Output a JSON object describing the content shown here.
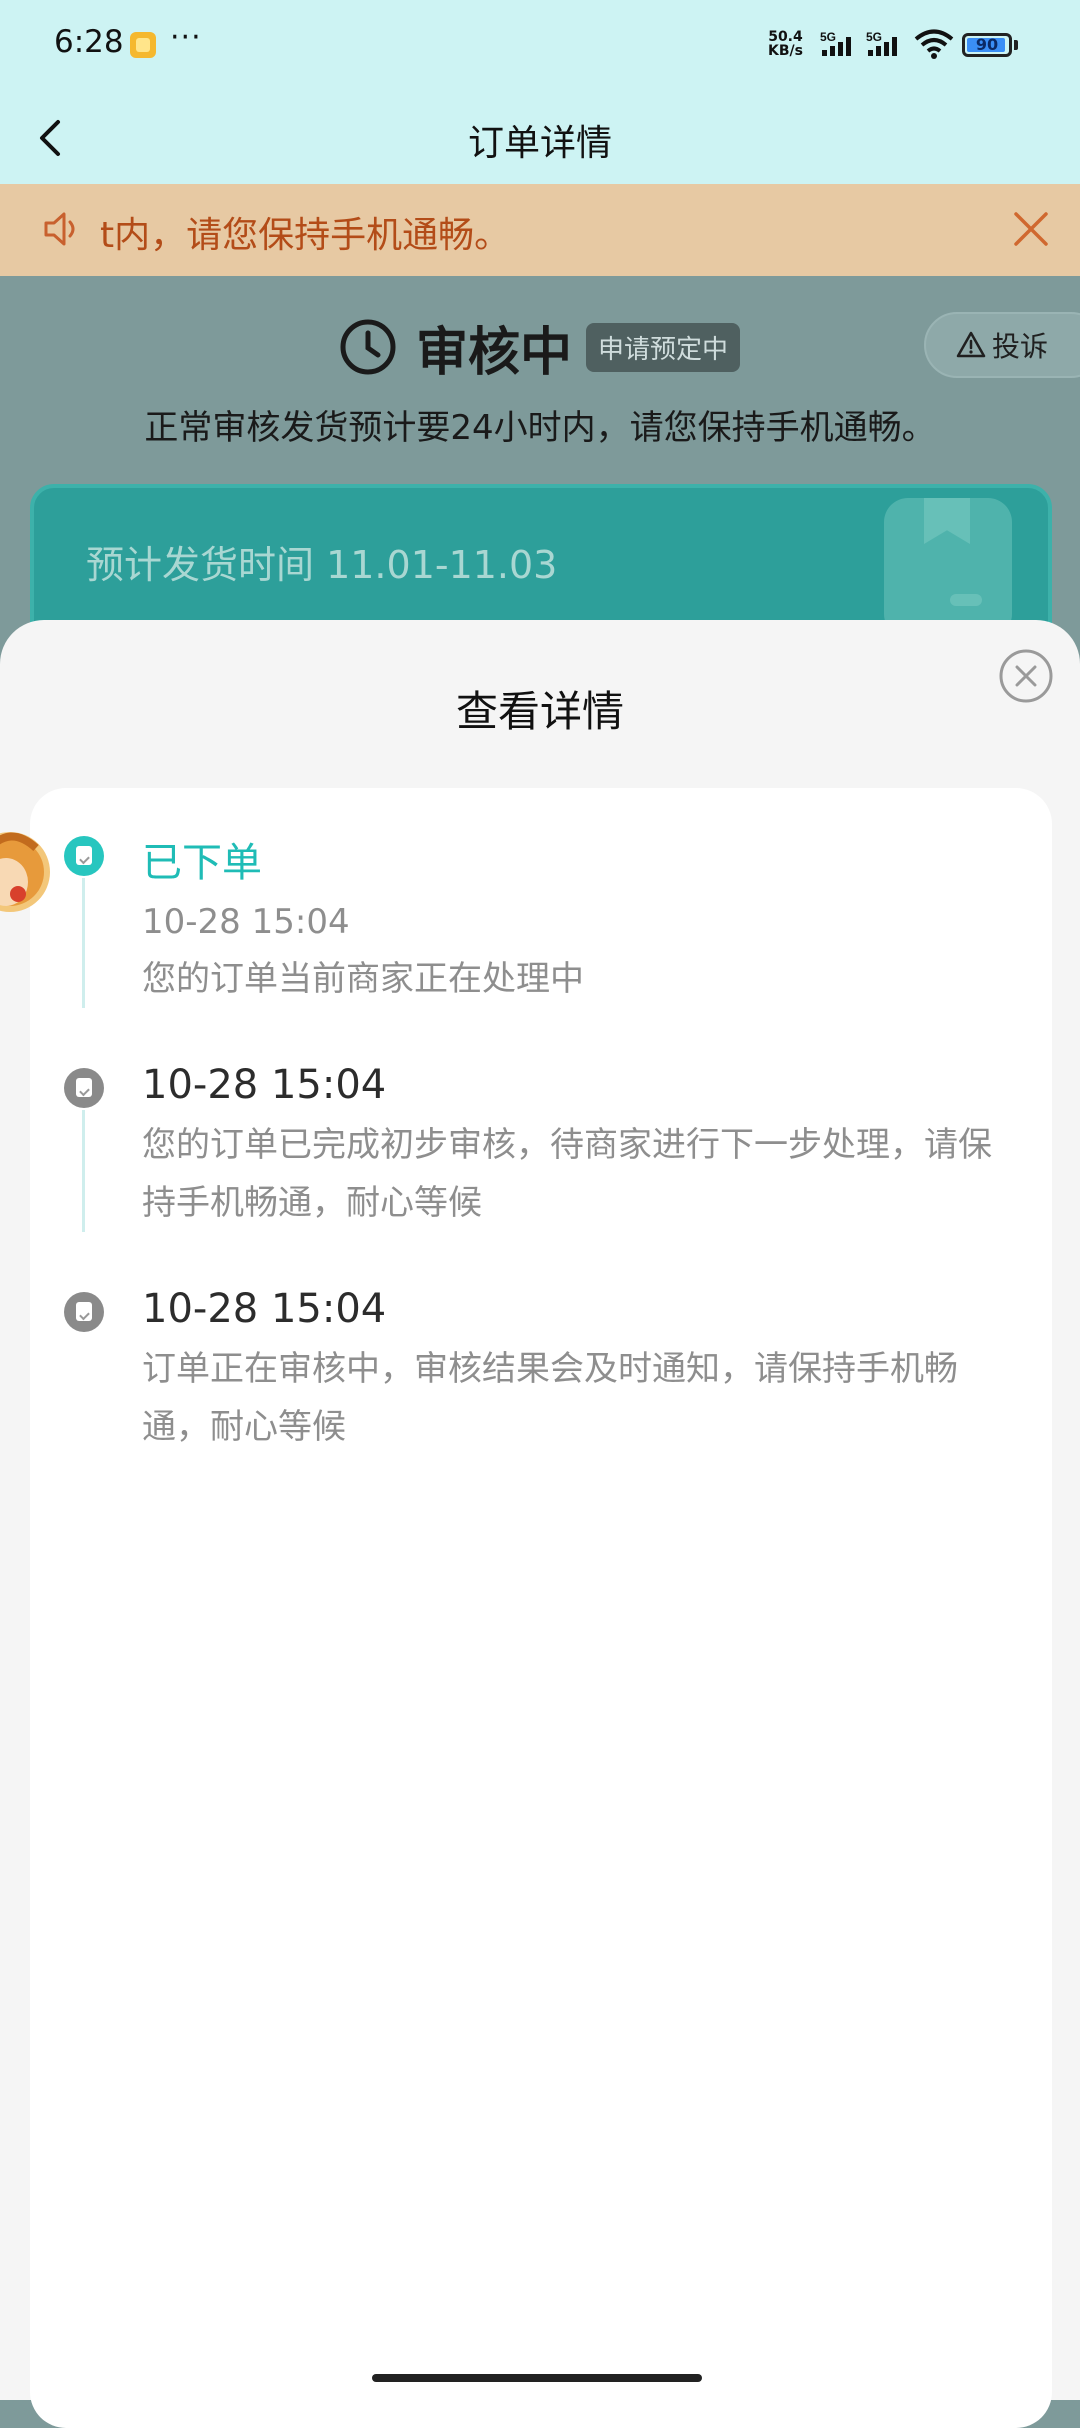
{
  "status_bar": {
    "time": "6:28",
    "more": "···",
    "net_speed_value": "50.4",
    "net_speed_unit": "KB/s",
    "sim1": "5G",
    "sim2": "5G",
    "battery": "90"
  },
  "nav": {
    "title": "订单详情"
  },
  "notice": {
    "text": "t内，请您保持手机通畅。"
  },
  "status": {
    "title": "审核中",
    "tag": "申请预定中",
    "complaint_label": "投诉",
    "description": "正常审核发货预计要24小时内，请您保持手机通畅。",
    "shipping_estimate": "预计发货时间 11.01-11.03"
  },
  "sheet": {
    "title": "查看详情",
    "timeline": [
      {
        "heading": "已下单",
        "time": "10-28 15:04",
        "description": "您的订单当前商家正在处理中",
        "active": true
      },
      {
        "heading": "10-28 15:04",
        "description": "您的订单已完成初步审核，待商家进行下一步处理，请保持手机畅通，耐心等候",
        "active": false
      },
      {
        "heading": "10-28 15:04",
        "description": "订单正在审核中，审核结果会及时通知，请保持手机畅通，耐心等候",
        "active": false
      }
    ]
  },
  "colors": {
    "accent_teal": "#1fbcb6",
    "notice_text": "#b34c18",
    "header_bg": "#cdf3f3"
  },
  "icons": [
    "back-arrow-icon",
    "speaker-icon",
    "close-icon",
    "clock-icon",
    "warning-icon",
    "package-icon",
    "close-circle-icon",
    "order-doc-icon",
    "mascot-avatar"
  ]
}
